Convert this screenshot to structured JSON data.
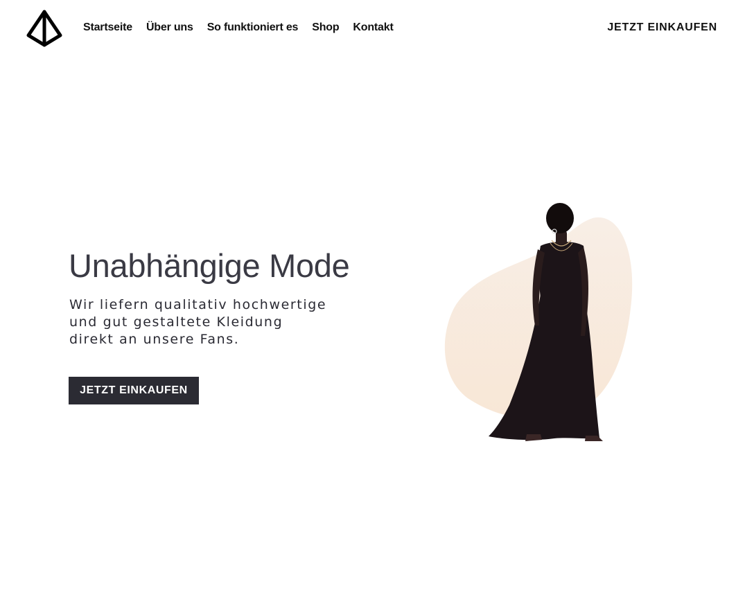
{
  "header": {
    "logo_icon": "triangle-logo-icon",
    "nav": [
      {
        "label": "Startseite"
      },
      {
        "label": "Über uns"
      },
      {
        "label": "So funktioniert es"
      },
      {
        "label": "Shop"
      },
      {
        "label": "Kontakt"
      }
    ],
    "cta_label": "JETZT EINKAUFEN"
  },
  "hero": {
    "title": "Unabhängige Mode",
    "text_lines": [
      "Wir liefern qualitativ hochwertige",
      "und gut gestaltete Kleidung",
      "direkt an unsere Fans."
    ],
    "button_label": "JETZT EINKAUFEN",
    "blob_color": "#f7e6d6",
    "dress_color": "#1c1418"
  }
}
